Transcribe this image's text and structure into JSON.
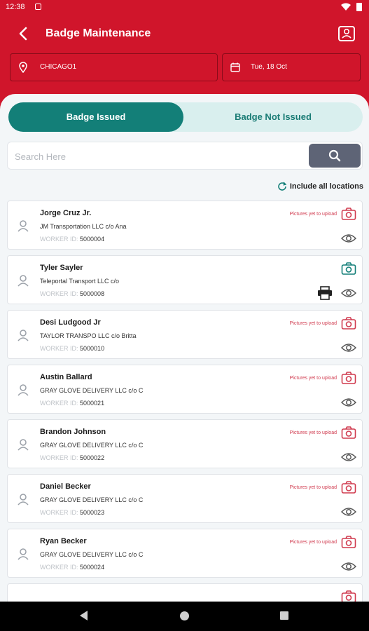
{
  "status_bar": {
    "time": "12:38"
  },
  "header": {
    "title": "Badge Maintenance",
    "location": "CHICAGO1",
    "date": "Tue, 18 Oct"
  },
  "tabs": {
    "issued": "Badge Issued",
    "not_issued": "Badge Not Issued"
  },
  "search": {
    "placeholder": "Search Here"
  },
  "include_label": "Include all locations",
  "colors": {
    "brand_red": "#d0152b",
    "teal": "#137f78",
    "pending_pink": "#d03a4e"
  },
  "workers": [
    {
      "name": "Jorge Cruz Jr.",
      "company": "JM Transportation LLC c/o Ana",
      "worker_label": "WORKER ID:",
      "worker_id": "5000004",
      "status": "Pictures yet to upload",
      "camera_state": "pending"
    },
    {
      "name": "Tyler Sayler",
      "company": "Teleportal Transport LLC c/o",
      "worker_label": "WORKER ID:",
      "worker_id": "5000008",
      "status": "",
      "camera_state": "uploaded"
    },
    {
      "name": "Desi Ludgood Jr",
      "company": "TAYLOR TRANSPO LLC c/o Britta",
      "worker_label": "WORKER ID:",
      "worker_id": "5000010",
      "status": "Pictures yet to upload",
      "camera_state": "pending"
    },
    {
      "name": "Austin Ballard",
      "company": "GRAY GLOVE DELIVERY LLC c/o C",
      "worker_label": "WORKER ID:",
      "worker_id": "5000021",
      "status": "Pictures yet to upload",
      "camera_state": "pending"
    },
    {
      "name": "Brandon Johnson",
      "company": "GRAY GLOVE DELIVERY LLC c/o C",
      "worker_label": "WORKER ID:",
      "worker_id": "5000022",
      "status": "Pictures yet to upload",
      "camera_state": "pending"
    },
    {
      "name": "Daniel Becker",
      "company": "GRAY GLOVE DELIVERY LLC c/o C",
      "worker_label": "WORKER ID:",
      "worker_id": "5000023",
      "status": "Pictures yet to upload",
      "camera_state": "pending"
    },
    {
      "name": "Ryan Becker",
      "company": "GRAY GLOVE DELIVERY LLC c/o C",
      "worker_label": "WORKER ID:",
      "worker_id": "5000024",
      "status": "Pictures yet to upload",
      "camera_state": "pending"
    },
    {
      "name": "",
      "company": "",
      "worker_label": "",
      "worker_id": "",
      "status": "",
      "camera_state": "pending"
    }
  ]
}
